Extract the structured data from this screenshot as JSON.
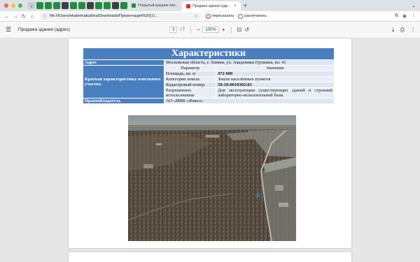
{
  "browser": {
    "tabs": [
      {
        "label": "Открытый аукцион пои...",
        "active": false
      },
      {
        "label": "Продажа здания (адр...",
        "active": true
      }
    ],
    "url": "file:///Users/ekaterinakuklina/Downloads/Презентация%20(1)...",
    "chips": [
      "пересказать",
      "распечатать"
    ]
  },
  "pdf": {
    "title": "Продажа здания (адрес)",
    "current_page": "3",
    "total_pages": "/ 7",
    "zoom": "100%"
  },
  "table": {
    "heading": "Характеристики",
    "address_label": "Адрес",
    "address_value": "Московская область, г. Химки, ул. Академика Грушина, вл. 41",
    "land_label": "Краткая характеристика земельного участка",
    "param_header": "Параметр",
    "value_header": "Значение",
    "rows": [
      {
        "param": "Площадь, кв. м",
        "value": "472 600"
      },
      {
        "param": "Категория земель",
        "value": "Земли населённых пунктов"
      },
      {
        "param": "Кадастровый номер",
        "value": "50:10:0010302:83"
      },
      {
        "param": "Разрешенное использование",
        "value": "Для эксплуатации существующих зданий и строений лабораторно-испытательной базы"
      }
    ],
    "owner_label": "Правообладатель",
    "owner_value": "АО «МКБ «Факел»"
  },
  "colors": {
    "header_blue": "#4a7fbf",
    "cell_light": "#dde6f2"
  }
}
